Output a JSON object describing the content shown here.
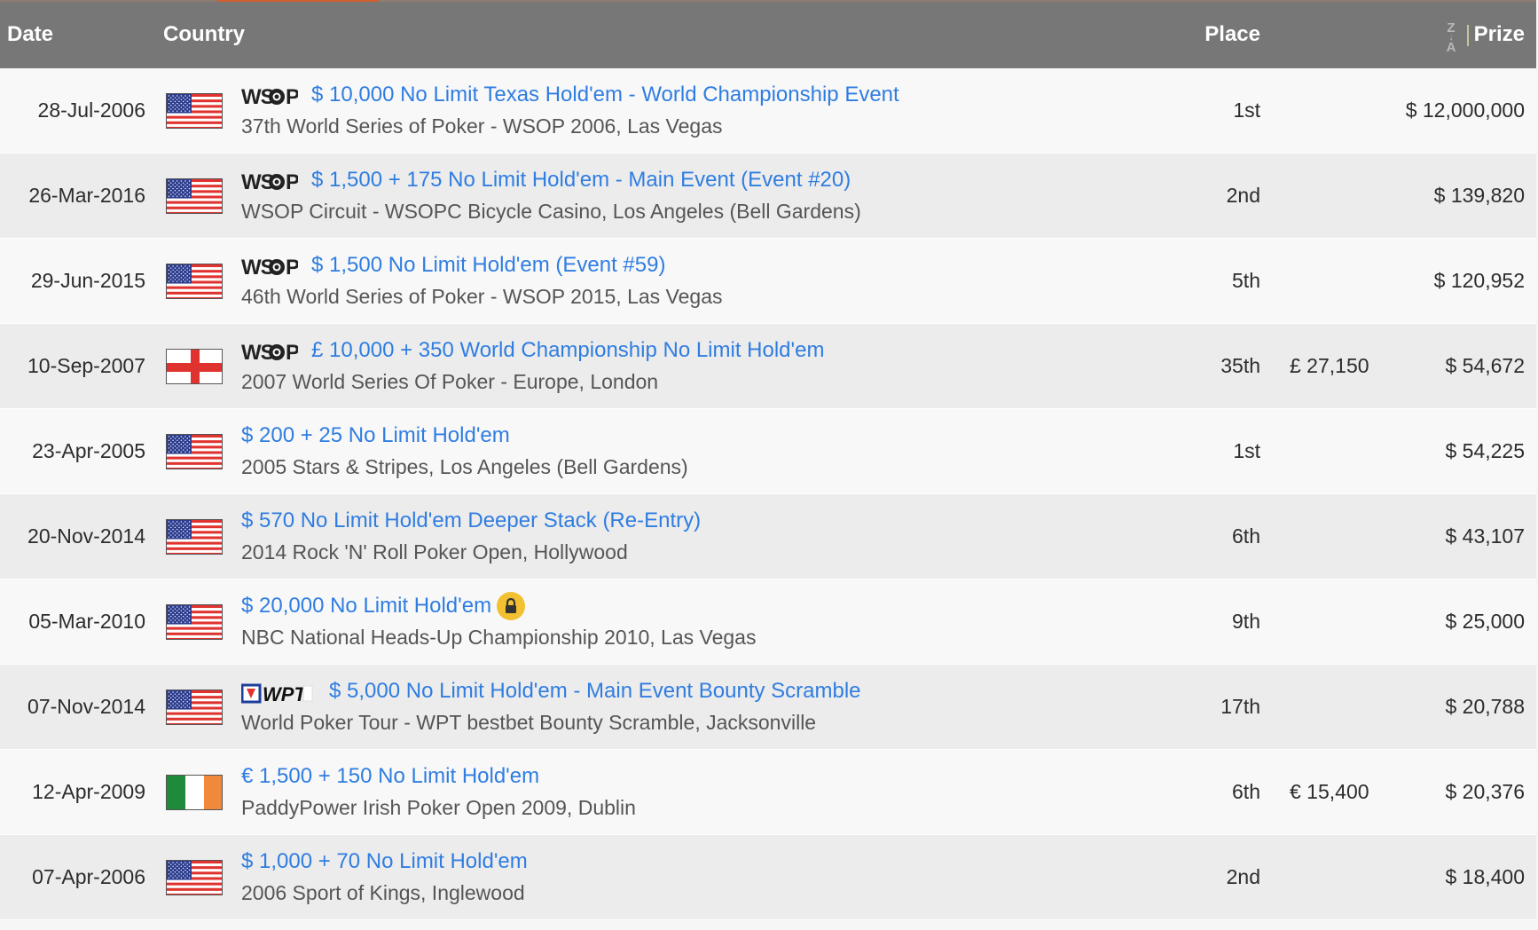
{
  "header": {
    "date": "Date",
    "country": "Country",
    "place": "Place",
    "prize": "Prize",
    "sort_icon": "sort-za-icon",
    "sort_top": "Z",
    "sort_bottom": "A",
    "bg": "#777777"
  },
  "colors": {
    "link": "#2f7de1",
    "row_odd": "#f8f8f8",
    "row_even": "#ececec",
    "accent": "#d1602e"
  },
  "rows": [
    {
      "date": "28-Jul-2006",
      "flag": "us",
      "logo": "wsop",
      "title": "$ 10,000 No Limit Texas Hold'em - World Championship Event",
      "sub": "37th World Series of Poker - WSOP 2006, Las Vegas",
      "place": "1st",
      "local": "",
      "prize": "$ 12,000,000"
    },
    {
      "date": "26-Mar-2016",
      "flag": "us",
      "logo": "wsop",
      "title": "$ 1,500 + 175 No Limit Hold'em - Main Event (Event #20)",
      "sub": "WSOP Circuit - WSOPC Bicycle Casino, Los Angeles (Bell Gardens)",
      "place": "2nd",
      "local": "",
      "prize": "$ 139,820"
    },
    {
      "date": "29-Jun-2015",
      "flag": "us",
      "logo": "wsop",
      "title": "$ 1,500 No Limit Hold'em (Event #59)",
      "sub": "46th World Series of Poker - WSOP 2015, Las Vegas",
      "place": "5th",
      "local": "",
      "prize": "$ 120,952"
    },
    {
      "date": "10-Sep-2007",
      "flag": "england",
      "logo": "wsop",
      "title": "£ 10,000 + 350 World Championship No Limit Hold'em",
      "sub": "2007 World Series Of Poker - Europe, London",
      "place": "35th",
      "local": "£ 27,150",
      "prize": "$ 54,672"
    },
    {
      "date": "23-Apr-2005",
      "flag": "us",
      "logo": "",
      "title": "$ 200 + 25 No Limit Hold'em",
      "sub": "2005 Stars & Stripes, Los Angeles (Bell Gardens)",
      "place": "1st",
      "local": "",
      "prize": "$ 54,225"
    },
    {
      "date": "20-Nov-2014",
      "flag": "us",
      "logo": "",
      "title": "$ 570 No Limit Hold'em Deeper Stack (Re-Entry)",
      "sub": "2014 Rock 'N' Roll Poker Open, Hollywood",
      "place": "6th",
      "local": "",
      "prize": "$ 43,107"
    },
    {
      "date": "05-Mar-2010",
      "flag": "us",
      "logo": "",
      "lock": true,
      "title": "$ 20,000 No Limit Hold'em",
      "sub": "NBC National Heads-Up Championship 2010, Las Vegas",
      "place": "9th",
      "local": "",
      "prize": "$ 25,000"
    },
    {
      "date": "07-Nov-2014",
      "flag": "us",
      "logo": "wpt",
      "title": "$ 5,000 No Limit Hold'em - Main Event Bounty Scramble",
      "sub": "World Poker Tour - WPT bestbet Bounty Scramble, Jacksonville",
      "place": "17th",
      "local": "",
      "prize": "$ 20,788"
    },
    {
      "date": "12-Apr-2009",
      "flag": "ireland",
      "logo": "",
      "title": "€ 1,500 + 150 No Limit Hold'em",
      "sub": "PaddyPower Irish Poker Open 2009, Dublin",
      "place": "6th",
      "local": "€ 15,400",
      "prize": "$ 20,376"
    },
    {
      "date": "07-Apr-2006",
      "flag": "us",
      "logo": "",
      "title": "$ 1,000 + 70 No Limit Hold'em",
      "sub": "2006 Sport of Kings, Inglewood",
      "place": "2nd",
      "local": "",
      "prize": "$ 18,400"
    }
  ]
}
